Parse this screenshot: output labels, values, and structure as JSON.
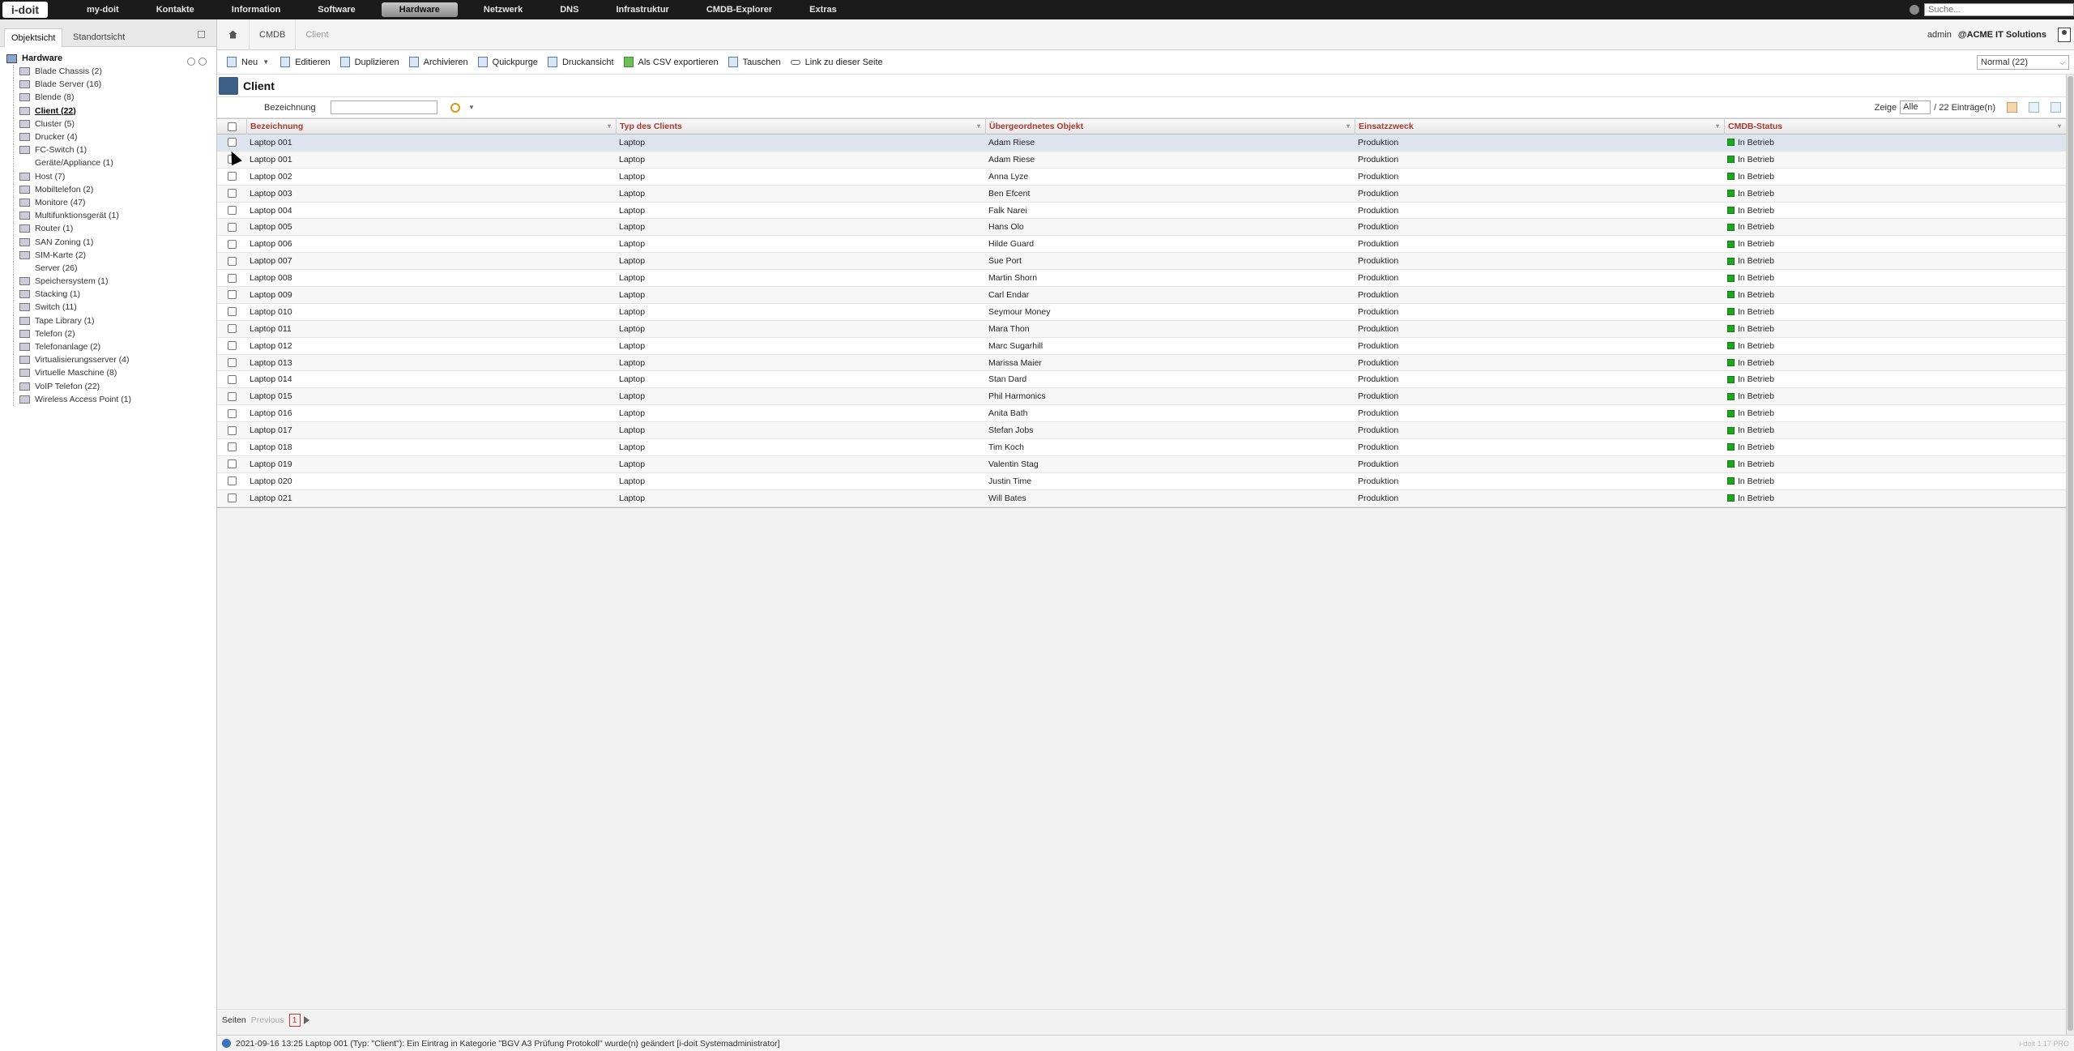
{
  "topnav": {
    "logo": "i-doit",
    "items": [
      "my-doit",
      "Kontakte",
      "Information",
      "Software",
      "Hardware",
      "Netzwerk",
      "DNS",
      "Infrastruktur",
      "CMDB-Explorer",
      "Extras"
    ],
    "active": "Hardware",
    "search_placeholder": "Suche..."
  },
  "left_tabs": [
    "Objektsicht",
    "Standortsicht"
  ],
  "tree": {
    "root": "Hardware",
    "items": [
      {
        "label": "Blade Chassis (2)",
        "icon": "blade-chassis-icon"
      },
      {
        "label": "Blade Server (16)",
        "icon": "blade-server-icon"
      },
      {
        "label": "Blende (8)",
        "icon": "blende-icon"
      },
      {
        "label": "Client (22)",
        "icon": "client-icon",
        "selected": true
      },
      {
        "label": "Cluster (5)",
        "icon": "cluster-icon"
      },
      {
        "label": "Drucker (4)",
        "icon": "printer-icon"
      },
      {
        "label": "FC-Switch (1)",
        "icon": "fc-switch-icon"
      },
      {
        "label": "Geräte/Appliance (1)",
        "icon": "none"
      },
      {
        "label": "Host (7)",
        "icon": "host-icon"
      },
      {
        "label": "Mobiltelefon (2)",
        "icon": "mobile-phone-icon"
      },
      {
        "label": "Monitore (47)",
        "icon": "monitor-icon"
      },
      {
        "label": "Multifunktionsgerät (1)",
        "icon": "multifunction-icon"
      },
      {
        "label": "Router (1)",
        "icon": "router-icon"
      },
      {
        "label": "SAN Zoning (1)",
        "icon": "san-zoning-icon"
      },
      {
        "label": "SIM-Karte (2)",
        "icon": "sim-card-icon"
      },
      {
        "label": "Server (26)",
        "icon": "none"
      },
      {
        "label": "Speichersystem (1)",
        "icon": "storage-icon"
      },
      {
        "label": "Stacking (1)",
        "icon": "stacking-icon"
      },
      {
        "label": "Switch (11)",
        "icon": "switch-icon"
      },
      {
        "label": "Tape Library (1)",
        "icon": "tape-library-icon"
      },
      {
        "label": "Telefon (2)",
        "icon": "phone-icon"
      },
      {
        "label": "Telefonanlage (2)",
        "icon": "pbx-icon"
      },
      {
        "label": "Virtualisierungsserver (4)",
        "icon": "virtualization-server-icon"
      },
      {
        "label": "Virtuelle Maschine (8)",
        "icon": "virtual-machine-icon"
      },
      {
        "label": "VoIP Telefon (22)",
        "icon": "voip-phone-icon"
      },
      {
        "label": "Wireless Access Point (1)",
        "icon": "wireless-ap-icon"
      }
    ]
  },
  "breadcrumb": [
    "CMDB",
    "Client"
  ],
  "user": {
    "name": "admin",
    "org": "@ACME IT Solutions"
  },
  "toolbar": {
    "buttons": [
      "Neu",
      "Editieren",
      "Duplizieren",
      "Archivieren",
      "Quickpurge",
      "Druckansicht",
      "Als CSV exportieren",
      "Tauschen",
      "Link zu dieser Seite"
    ],
    "view_select": "Normal (22)"
  },
  "page": {
    "title": "Client"
  },
  "filter": {
    "label": "Bezeichnung",
    "value": ""
  },
  "pagesize": {
    "label": "Zeige",
    "value": "Alle",
    "count_text": "/ 22 Einträge(n)"
  },
  "table": {
    "columns": [
      "Bezeichnung",
      "Typ des Clients",
      "Übergeordnetes Objekt",
      "Einsatzzweck",
      "CMDB-Status"
    ],
    "status_color": "#1fa51f",
    "rows": [
      [
        "Laptop 001",
        "Laptop",
        "Adam Riese",
        "Produktion",
        "In Betrieb"
      ],
      [
        "Laptop 001",
        "Laptop",
        "Adam Riese",
        "Produktion",
        "In Betrieb"
      ],
      [
        "Laptop 002",
        "Laptop",
        "Anna Lyze",
        "Produktion",
        "In Betrieb"
      ],
      [
        "Laptop 003",
        "Laptop",
        "Ben Efcent",
        "Produktion",
        "In Betrieb"
      ],
      [
        "Laptop 004",
        "Laptop",
        "Falk Narei",
        "Produktion",
        "In Betrieb"
      ],
      [
        "Laptop 005",
        "Laptop",
        "Hans Olo",
        "Produktion",
        "In Betrieb"
      ],
      [
        "Laptop 006",
        "Laptop",
        "Hilde Guard",
        "Produktion",
        "In Betrieb"
      ],
      [
        "Laptop 007",
        "Laptop",
        "Sue Port",
        "Produktion",
        "In Betrieb"
      ],
      [
        "Laptop 008",
        "Laptop",
        "Martin Shorn",
        "Produktion",
        "In Betrieb"
      ],
      [
        "Laptop 009",
        "Laptop",
        "Carl Endar",
        "Produktion",
        "In Betrieb"
      ],
      [
        "Laptop 010",
        "Laptop",
        "Seymour Money",
        "Produktion",
        "In Betrieb"
      ],
      [
        "Laptop 011",
        "Laptop",
        "Mara Thon",
        "Produktion",
        "In Betrieb"
      ],
      [
        "Laptop 012",
        "Laptop",
        "Marc Sugarhill",
        "Produktion",
        "In Betrieb"
      ],
      [
        "Laptop 013",
        "Laptop",
        "Marissa Maier",
        "Produktion",
        "In Betrieb"
      ],
      [
        "Laptop 014",
        "Laptop",
        "Stan Dard",
        "Produktion",
        "In Betrieb"
      ],
      [
        "Laptop 015",
        "Laptop",
        "Phil Harmonics",
        "Produktion",
        "In Betrieb"
      ],
      [
        "Laptop 016",
        "Laptop",
        "Anita Bath",
        "Produktion",
        "In Betrieb"
      ],
      [
        "Laptop 017",
        "Laptop",
        "Stefan Jobs",
        "Produktion",
        "In Betrieb"
      ],
      [
        "Laptop 018",
        "Laptop",
        "Tim Koch",
        "Produktion",
        "In Betrieb"
      ],
      [
        "Laptop 019",
        "Laptop",
        "Valentin Stag",
        "Produktion",
        "In Betrieb"
      ],
      [
        "Laptop 020",
        "Laptop",
        "Justin Time",
        "Produktion",
        "In Betrieb"
      ],
      [
        "Laptop 021",
        "Laptop",
        "Will Bates",
        "Produktion",
        "In Betrieb"
      ]
    ]
  },
  "pager": {
    "label": "Seiten",
    "previous": "Previous",
    "current": "1"
  },
  "statusbar": {
    "message": "2021-09-16 13:25 Laptop 001 (Typ: \"Client\"): Ein Eintrag in Kategorie \"BGV A3 Prüfung Protokoll\" wurde(n) geändert [i-doit Systemadministrator]",
    "version": "i-doit 1.17 PRO"
  }
}
